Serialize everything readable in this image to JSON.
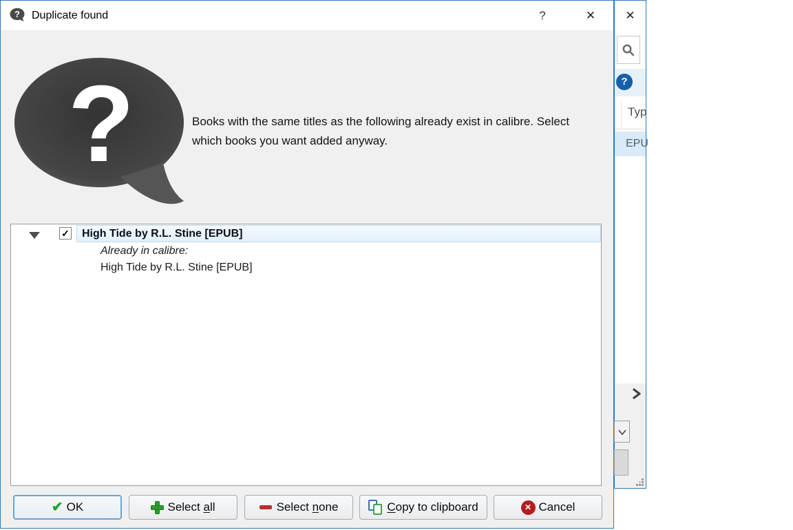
{
  "dialog": {
    "title": "Duplicate found",
    "titlebar": {
      "help_glyph": "?",
      "close_glyph": "✕"
    },
    "message": "Books with the same titles as the following already exist in calibre. Select which books you want added anyway.",
    "tree": {
      "check_glyph": "✓",
      "item_title": "High Tide by R.L. Stine [EPUB]",
      "already_label": "Already in calibre:",
      "existing_title": "High Tide by R.L. Stine [EPUB]"
    },
    "buttons": {
      "ok": {
        "label": "OK",
        "icon": "check-icon",
        "icon_glyph": "✔"
      },
      "select_all": {
        "pre": "Select ",
        "mnemonic": "a",
        "post": "ll",
        "icon": "plus-icon"
      },
      "select_none": {
        "pre": "Select ",
        "mnemonic": "n",
        "post": "one",
        "icon": "minus-icon"
      },
      "copy": {
        "pre": "",
        "mnemonic": "C",
        "post": "opy to clipboard",
        "icon": "copy-icon"
      },
      "cancel": {
        "label": "Cancel",
        "icon": "cancel-x-icon",
        "icon_glyph": "✕"
      }
    },
    "bubble_glyph": "?"
  },
  "background_window": {
    "close_glyph": "✕",
    "help_glyph": "?",
    "column_header": "Typ",
    "visible_row": "EPU",
    "icons": [
      "search-icon",
      "chevron-right-icon",
      "chevron-down-icon",
      "resize-grip"
    ]
  },
  "colors": {
    "accent_border": "#2b7bba",
    "selection_bg": "#e9f4fc",
    "selection_border": "#bcdcf4",
    "ok_border": "#67a4d8",
    "icon_green": "#27a22b",
    "icon_red": "#c02b2b",
    "cancel_red": "#b71c1c",
    "copy_blue": "#3f6fb0",
    "copy_green": "#44a04a",
    "help_blue": "#1560a8",
    "row_blue": "#d9eaf8"
  }
}
